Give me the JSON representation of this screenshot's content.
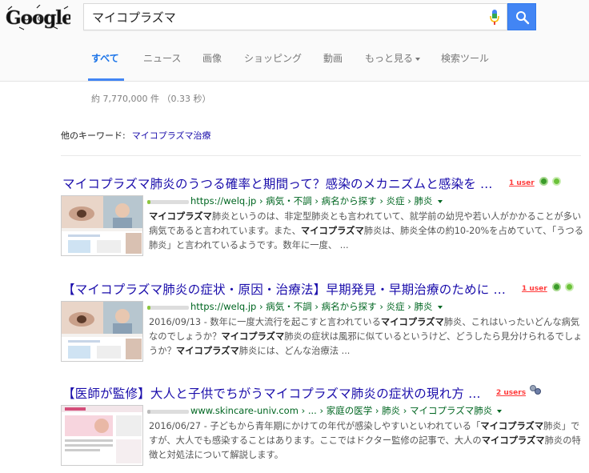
{
  "search": {
    "query": "マイコプラズマ"
  },
  "tabs": [
    {
      "label": "すべて",
      "active": true
    },
    {
      "label": "ニュース"
    },
    {
      "label": "画像"
    },
    {
      "label": "ショッピング"
    },
    {
      "label": "動画"
    },
    {
      "label": "もっと見る"
    },
    {
      "label": "検索ツール"
    }
  ],
  "stats": "約 7,770,000 件 （0.33 秒）",
  "related": {
    "label": "他のキーワード:",
    "link": "マイコプラズマ治療"
  },
  "results": [
    {
      "title": "マイコプラズマ肺炎のうつる確率と期間って？感染のメカニズムと感染を ...",
      "badge": "1 user",
      "url": "https://welq.jp › 病気・不調 › 病名から探す › 炎症 › 肺炎",
      "snippet_parts": [
        {
          "b": "マイコプラズマ"
        },
        {
          "t": "肺炎というのは、非定型肺炎とも言われていて、就学前の幼児や若い人がかかることが多い病気であると言われています。また、"
        },
        {
          "b": "マイコプラズマ"
        },
        {
          "t": "肺炎は、肺炎全体の約10-20%を占めていて、「うつる肺炎」と言われているようです。数年に一度、 ..."
        }
      ]
    },
    {
      "title": "【マイコプラズマ肺炎の症状・原因・治療法】早期発見・早期治療のために ...",
      "badge": "1 user",
      "url": "https://welq.jp › 病気・不調 › 病名から探す › 炎症 › 肺炎",
      "snippet_parts": [
        {
          "t": "2016/09/13 - 数年に一度大流行を起こすと言われている"
        },
        {
          "b": "マイコプラズマ"
        },
        {
          "t": "肺炎、これはいったいどんな病気なのでしょうか？"
        },
        {
          "b": "マイコプラズマ"
        },
        {
          "t": "肺炎の症状は風邪に似ているというけど、どうしたら見分けられるでしょうか？"
        },
        {
          "b": "マイコプラズマ"
        },
        {
          "t": "肺炎には、どんな治療法 ..."
        }
      ]
    },
    {
      "title": "【医師が監修】大人と子供でちがうマイコプラズマ肺炎の症状の現れ方 ...",
      "badge": "2 users",
      "url": "www.skincare-univ.com › ... › 家庭の医学 › 肺炎 › マイコプラズマ肺炎",
      "snippet_parts": [
        {
          "t": "2016/06/27 - 子どもから青年期にかけての年代が感染しやすいといわれている「"
        },
        {
          "b": "マイコプラズマ"
        },
        {
          "t": "肺炎」ですが、大人でも感染することはあります。ここではドクター監修の記事で、大人の"
        },
        {
          "b": "マイコプラズマ"
        },
        {
          "t": "肺炎の特徴と対処法について解説します。"
        }
      ]
    }
  ],
  "colors": {
    "link": "#1a0dab",
    "url": "#006621",
    "accent": "#4285f4",
    "badge": "#ff3b3b"
  },
  "icons": [
    "google-logo",
    "microphone-icon",
    "search-icon",
    "chevron-down-icon",
    "hatena-badge"
  ]
}
